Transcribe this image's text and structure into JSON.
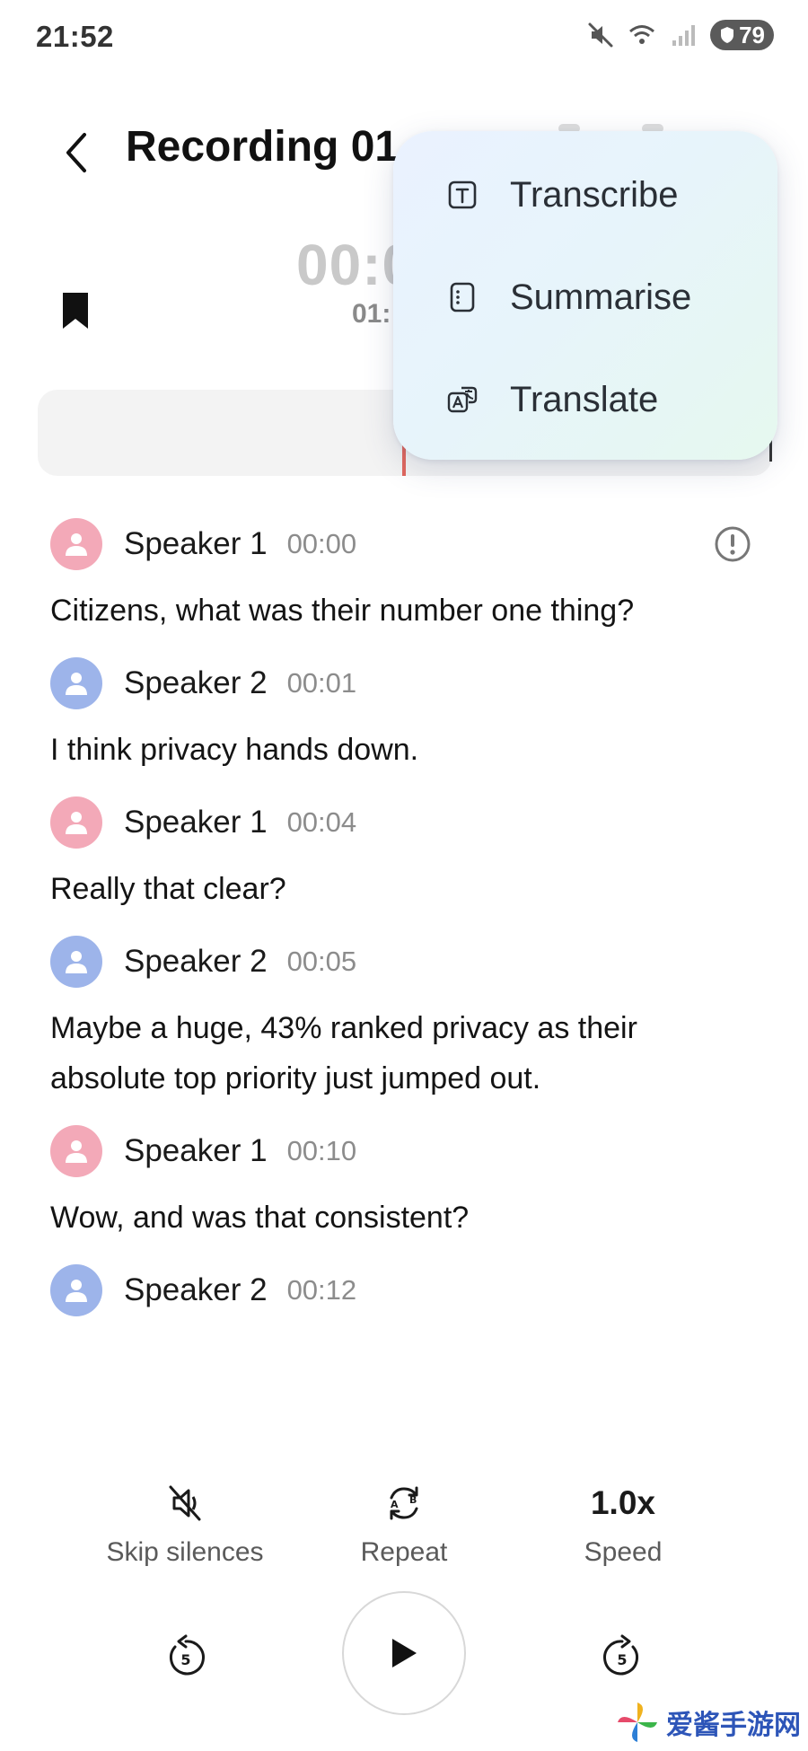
{
  "status_bar": {
    "time": "21:52",
    "battery": "79",
    "icons": [
      "mute-icon",
      "wifi-icon",
      "signal-icon",
      "battery-icon"
    ]
  },
  "header": {
    "title": "Recording 01"
  },
  "player": {
    "time_main": "00:0",
    "time_sub": "01:"
  },
  "menu": {
    "items": [
      {
        "label": "Transcribe",
        "icon": "transcribe-icon"
      },
      {
        "label": "Summarise",
        "icon": "summarise-icon"
      },
      {
        "label": "Translate",
        "icon": "translate-icon"
      }
    ]
  },
  "transcript": [
    {
      "speaker": "Speaker 1",
      "time": "00:00",
      "text": "Citizens, what was their number one thing?",
      "color": "#f3a9b8"
    },
    {
      "speaker": "Speaker 2",
      "time": "00:01",
      "text": "I think privacy hands down.",
      "color": "#9db4ea"
    },
    {
      "speaker": "Speaker 1",
      "time": "00:04",
      "text": "Really that clear?",
      "color": "#f3a9b8"
    },
    {
      "speaker": "Speaker 2",
      "time": "00:05",
      "text": "Maybe a huge, 43% ranked privacy as their absolute top priority just jumped out.",
      "color": "#9db4ea"
    },
    {
      "speaker": "Speaker 1",
      "time": "00:10",
      "text": "Wow, and was that consistent?",
      "color": "#f3a9b8"
    },
    {
      "speaker": "Speaker 2",
      "time": "00:12",
      "text": "",
      "color": "#9db4ea"
    }
  ],
  "controls": {
    "skip_silences": "Skip silences",
    "repeat": "Repeat",
    "speed_value": "1.0x",
    "speed": "Speed",
    "skip_seconds": "5"
  },
  "watermark": {
    "text": "爱酱手游网"
  },
  "colors": {
    "accent_red": "#e0665d",
    "speaker1_avatar": "#f3a9b8",
    "speaker2_avatar": "#9db4ea"
  }
}
